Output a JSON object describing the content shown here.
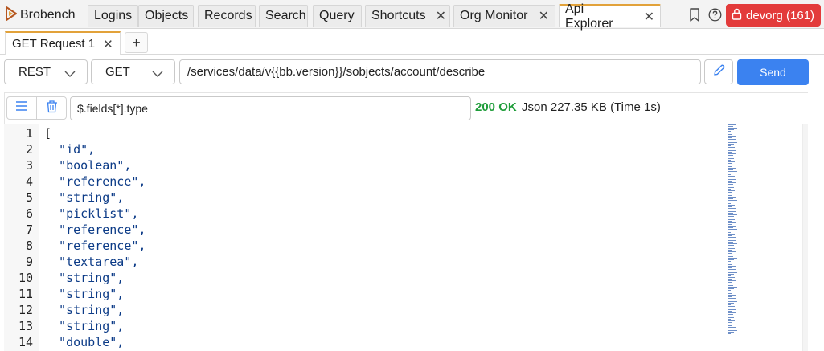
{
  "app": {
    "name": "Brobench"
  },
  "nav": {
    "tabs": [
      {
        "label": "Logins",
        "closable": false
      },
      {
        "label": "Objects",
        "closable": false
      },
      {
        "label": "Records",
        "closable": false
      },
      {
        "label": "Search",
        "closable": false
      },
      {
        "label": "Query",
        "closable": false
      },
      {
        "label": "Shortcuts",
        "closable": true
      },
      {
        "label": "Org Monitor",
        "closable": true
      },
      {
        "label": "Api Explorer",
        "closable": true,
        "active": true
      }
    ],
    "close_glyph": "✕",
    "org_badge": "devorg (161)",
    "icons": [
      "bookmark-icon",
      "help-icon",
      "lock-icon"
    ]
  },
  "request_tabs": {
    "items": [
      {
        "label": "GET Request 1"
      }
    ],
    "close_glyph": "✕",
    "add_glyph": "+"
  },
  "request": {
    "api_type": "REST",
    "method": "GET",
    "url": "/services/data/v{{bb.version}}/sobjects/account/describe",
    "send_label": "Send"
  },
  "response": {
    "filter": "$.fields[*].type",
    "status": "200 OK",
    "info": "Json 227.35 KB (Time 1s)",
    "lines": [
      {
        "num": "1",
        "text": "["
      },
      {
        "num": "2",
        "text": "  \"id\","
      },
      {
        "num": "3",
        "text": "  \"boolean\","
      },
      {
        "num": "4",
        "text": "  \"reference\","
      },
      {
        "num": "5",
        "text": "  \"string\","
      },
      {
        "num": "6",
        "text": "  \"picklist\","
      },
      {
        "num": "7",
        "text": "  \"reference\","
      },
      {
        "num": "8",
        "text": "  \"reference\","
      },
      {
        "num": "9",
        "text": "  \"textarea\","
      },
      {
        "num": "10",
        "text": "  \"string\","
      },
      {
        "num": "11",
        "text": "  \"string\","
      },
      {
        "num": "12",
        "text": "  \"string\","
      },
      {
        "num": "13",
        "text": "  \"string\","
      },
      {
        "num": "14",
        "text": "  \"double\","
      }
    ]
  },
  "colors": {
    "accent_tab": "#e2a23a",
    "send": "#3b82f0",
    "org_badge": "#e33b3b",
    "status_ok": "#1f9d3a",
    "string_token": "#0c3b87"
  }
}
